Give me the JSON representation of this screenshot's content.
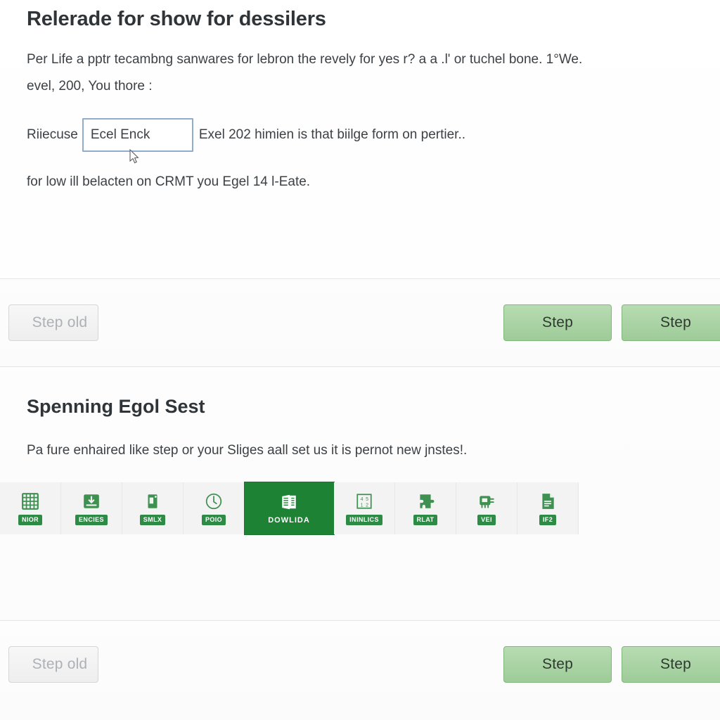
{
  "section_one": {
    "title": "Relerade for show for dessilers",
    "paragraph_line_1": "Per Life a pptr tecambng sanwares for lebron the revely for yes r? a a .l' or tuchel bone. 1°We.",
    "paragraph_line_2": "evel, 200, You thore :",
    "input_row": {
      "label_before": "Riiecuse",
      "input_value": "Ecel Enck",
      "input_placeholder": "Ecel Enck",
      "label_after": "Exel 202 himien is that biilge form on pertier.."
    },
    "paragraph_line_3": "for low ill belacten on CRMT you Egel 14 l-Eate."
  },
  "action_bar_one": {
    "secondary_label": "Step old",
    "primary_label_1": "Step",
    "primary_label_2": "Step"
  },
  "section_two": {
    "title": "Spenning Egol Sest",
    "paragraph": "Pa fure enhaired like step or your Sliges aall set us it is pernot new jnstes!.",
    "icons": [
      {
        "caption": "NIOR",
        "icon": "grid-icon",
        "active": false
      },
      {
        "caption": "ENCIES",
        "icon": "download-tray-icon",
        "active": false
      },
      {
        "caption": "SMLX",
        "icon": "bin-icon",
        "active": false
      },
      {
        "caption": "POIO",
        "icon": "clock-icon",
        "active": false
      },
      {
        "caption": "DOWLIDA",
        "icon": "spreadsheet-icon",
        "active": true
      },
      {
        "caption": "ININLICS",
        "icon": "numbers-frame-icon",
        "active": false
      },
      {
        "caption": "RLAT",
        "icon": "puzzle-icon",
        "active": false
      },
      {
        "caption": "VEI",
        "icon": "plug-box-icon",
        "active": false
      },
      {
        "caption": "IF2",
        "icon": "document-icon",
        "active": false
      }
    ]
  },
  "action_bar_two": {
    "secondary_label": "Step old",
    "primary_label_1": "Step",
    "primary_label_2": "Step"
  },
  "colors": {
    "accent_green": "#1e8235",
    "button_green": "#9ecb98",
    "input_border_blue": "#8fadcb",
    "text_dark": "#2f3438",
    "divider": "#e2e4e6"
  }
}
